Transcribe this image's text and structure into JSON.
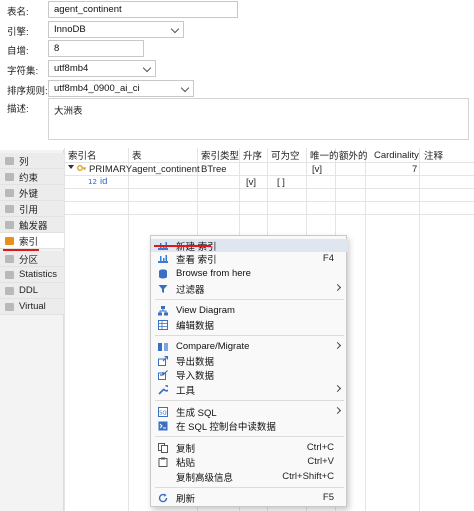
{
  "form": {
    "name_label": "表名:",
    "name_value": "agent_continent",
    "engine_label": "引擎:",
    "engine_value": "InnoDB",
    "autoinc_label": "自增:",
    "autoinc_value": "8",
    "charset_label": "字符集:",
    "charset_value": "utf8mb4",
    "collation_label": "排序规则:",
    "collation_value": "utf8mb4_0900_ai_ci",
    "comment_label": "描述:",
    "comment_value": "大洲表"
  },
  "sidebar": {
    "items": [
      {
        "label": "列"
      },
      {
        "label": "约束"
      },
      {
        "label": "外键"
      },
      {
        "label": "引用"
      },
      {
        "label": "触发器"
      },
      {
        "label": "索引"
      },
      {
        "label": "分区"
      },
      {
        "label": "Statistics"
      },
      {
        "label": "DDL"
      },
      {
        "label": "Virtual"
      }
    ],
    "active_index": 5
  },
  "grid": {
    "headers": [
      "索引名",
      "表",
      "索引类型",
      "升序",
      "可为空",
      "唯一的",
      "额外的",
      "Cardinality",
      "注释"
    ],
    "row": {
      "name": "PRIMARY",
      "table": "agent_continent",
      "type": "BTree",
      "unique": "[v]",
      "cardinality": "7"
    },
    "subrow": {
      "column": "id",
      "asc": "[v]",
      "nullable": "[ ]"
    }
  },
  "context_menu": {
    "items": [
      {
        "label": "新建 索引",
        "shortcut": "",
        "icon": "new-index-icon",
        "submenu": false
      },
      {
        "label": "查看 索引",
        "shortcut": "F4",
        "icon": "view-index-icon",
        "submenu": false
      },
      {
        "label": "Browse from here",
        "shortcut": "",
        "icon": "database-icon",
        "submenu": false
      },
      {
        "label": "过滤器",
        "shortcut": "",
        "icon": "filter-icon",
        "submenu": true
      },
      {
        "label": "View Diagram",
        "shortcut": "",
        "icon": "diagram-icon",
        "submenu": false
      },
      {
        "label": "编辑数据",
        "shortcut": "",
        "icon": "edit-data-icon",
        "submenu": false
      },
      {
        "label": "Compare/Migrate",
        "shortcut": "",
        "icon": "compare-icon",
        "submenu": true
      },
      {
        "label": "导出数据",
        "shortcut": "",
        "icon": "export-icon",
        "submenu": false
      },
      {
        "label": "导入数据",
        "shortcut": "",
        "icon": "import-icon",
        "submenu": false
      },
      {
        "label": "工具",
        "shortcut": "",
        "icon": "tools-icon",
        "submenu": true
      },
      {
        "label": "生成 SQL",
        "shortcut": "",
        "icon": "sql-icon",
        "submenu": true
      },
      {
        "label": "在 SQL 控制台中读数据",
        "shortcut": "",
        "icon": "sql-console-icon",
        "submenu": false
      },
      {
        "label": "复制",
        "shortcut": "Ctrl+C",
        "icon": "copy-icon",
        "submenu": false
      },
      {
        "label": "粘贴",
        "shortcut": "Ctrl+V",
        "icon": "paste-icon",
        "submenu": false
      },
      {
        "label": "复制高级信息",
        "shortcut": "Ctrl+Shift+C",
        "icon": "copy-advanced-icon",
        "submenu": false
      },
      {
        "label": "刷新",
        "shortcut": "F5",
        "icon": "refresh-icon",
        "submenu": false
      }
    ]
  }
}
